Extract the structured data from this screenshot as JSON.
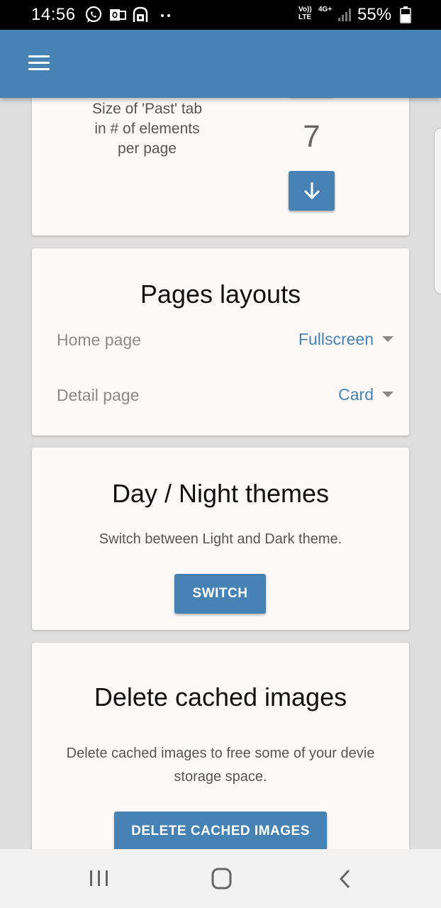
{
  "status_bar": {
    "time": "14:56",
    "network_label_top": "Vo))",
    "network_label_bottom": "LTE",
    "network_type": "4G+",
    "battery": "55%",
    "icons": [
      "whatsapp-icon",
      "outlook-icon",
      "vpn-icon",
      "more-dots-icon",
      "signal-icon",
      "battery-icon"
    ]
  },
  "app_bar": {
    "menu_icon": "hamburger-menu-icon",
    "color": "#4682b4"
  },
  "past_tab_card": {
    "label": "Size of 'Past' tab in # of elements per page",
    "value": "7",
    "up_icon": "arrow-up-icon",
    "down_icon": "arrow-down-icon"
  },
  "layouts_card": {
    "title": "Pages layouts",
    "rows": [
      {
        "label": "Home page",
        "value": "Fullscreen"
      },
      {
        "label": "Detail page",
        "value": "Card"
      }
    ]
  },
  "theme_card": {
    "title": "Day / Night themes",
    "description": "Switch between Light and Dark theme.",
    "button_label": "SWITCH"
  },
  "delete_card": {
    "title": "Delete cached images",
    "description": "Delete cached images to free some of your devie storage space.",
    "button_label": "DELETE CACHED IMAGES"
  },
  "nav_bar": {
    "icons": [
      "recent-apps-icon",
      "home-icon",
      "back-icon"
    ]
  }
}
